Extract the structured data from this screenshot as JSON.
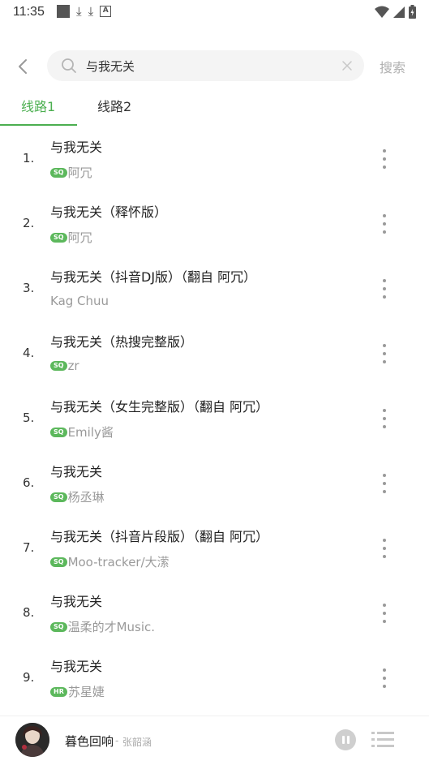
{
  "status_bar": {
    "time": "11:35"
  },
  "search": {
    "value": "与我无关",
    "button_label": "搜索"
  },
  "tabs": [
    {
      "label": "线路1"
    },
    {
      "label": "线路2"
    }
  ],
  "results": [
    {
      "index": "1.",
      "title": "与我无关",
      "badge": "SQ",
      "artist": "阿冗"
    },
    {
      "index": "2.",
      "title": "与我无关（释怀版）",
      "badge": "SQ",
      "artist": "阿冗"
    },
    {
      "index": "3.",
      "title": "与我无关（抖音DJ版）（翻自 阿冗）",
      "badge": "",
      "artist": "Kag Chuu"
    },
    {
      "index": "4.",
      "title": "与我无关（热搜完整版）",
      "badge": "SQ",
      "artist": "zr"
    },
    {
      "index": "5.",
      "title": "与我无关（女生完整版）（翻自 阿冗）",
      "badge": "SQ",
      "artist": "Emily酱"
    },
    {
      "index": "6.",
      "title": "与我无关",
      "badge": "SQ",
      "artist": "杨丞琳"
    },
    {
      "index": "7.",
      "title": "与我无关（抖音片段版）（翻自 阿冗）",
      "badge": "SQ",
      "artist": "Moo-tracker/大潆"
    },
    {
      "index": "8.",
      "title": "与我无关",
      "badge": "SQ",
      "artist": "温柔的才Music."
    },
    {
      "index": "9.",
      "title": "与我无关",
      "badge": "HR",
      "artist": "苏星婕"
    }
  ],
  "player": {
    "title": "暮色回响",
    "separator": "-",
    "artist": "张韶涵"
  },
  "colors": {
    "accent": "#4caf50",
    "badge": "#5cb85c",
    "muted": "#9a9a9a"
  },
  "icons": [
    "back-icon",
    "search-icon",
    "clear-icon",
    "more-icon",
    "pause-icon",
    "queue-icon"
  ]
}
